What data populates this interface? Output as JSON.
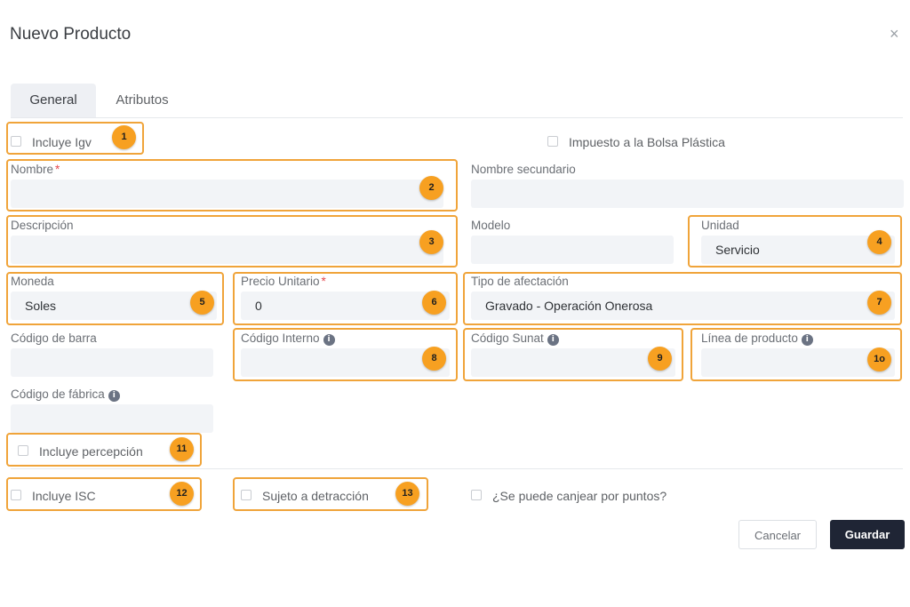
{
  "modal": {
    "title": "Nuevo Producto",
    "close_glyph": "×"
  },
  "tabs": [
    {
      "label": "General",
      "active": true
    },
    {
      "label": "Atributos",
      "active": false
    }
  ],
  "checkboxes": {
    "incluye_igv": "Incluye Igv",
    "bolsa": "Impuesto a la Bolsa Plástica",
    "percepcion": "Incluye percepción",
    "isc": "Incluye ISC",
    "detraccion": "Sujeto a detracción",
    "puntos": "¿Se puede canjear por puntos?"
  },
  "fields": {
    "nombre": {
      "label": "Nombre",
      "value": ""
    },
    "nombre_secundario": {
      "label": "Nombre secundario",
      "value": ""
    },
    "descripcion": {
      "label": "Descripción",
      "value": ""
    },
    "modelo": {
      "label": "Modelo",
      "value": ""
    },
    "unidad": {
      "label": "Unidad",
      "value": "Servicio"
    },
    "moneda": {
      "label": "Moneda",
      "value": "Soles"
    },
    "precio": {
      "label": "Precio Unitario",
      "value": "0"
    },
    "afectacion": {
      "label": "Tipo de afectación",
      "value": "Gravado - Operación Onerosa"
    },
    "barra": {
      "label": "Código de barra",
      "value": ""
    },
    "interno": {
      "label": "Código Interno",
      "value": ""
    },
    "sunat": {
      "label": "Código Sunat",
      "value": ""
    },
    "linea": {
      "label": "Línea de producto",
      "value": ""
    },
    "fabrica": {
      "label": "Código de fábrica",
      "value": ""
    }
  },
  "required_mark": "*",
  "info_glyph": "i",
  "badges": [
    "1",
    "2",
    "3",
    "4",
    "5",
    "6",
    "7",
    "8",
    "9",
    "1o",
    "11",
    "12",
    "13"
  ],
  "buttons": {
    "cancel": "Cancelar",
    "save": "Guardar"
  },
  "colors": {
    "highlight": "#f0a43a",
    "badge": "#f7a021",
    "primary": "#1f2535",
    "required": "#e5484d"
  }
}
